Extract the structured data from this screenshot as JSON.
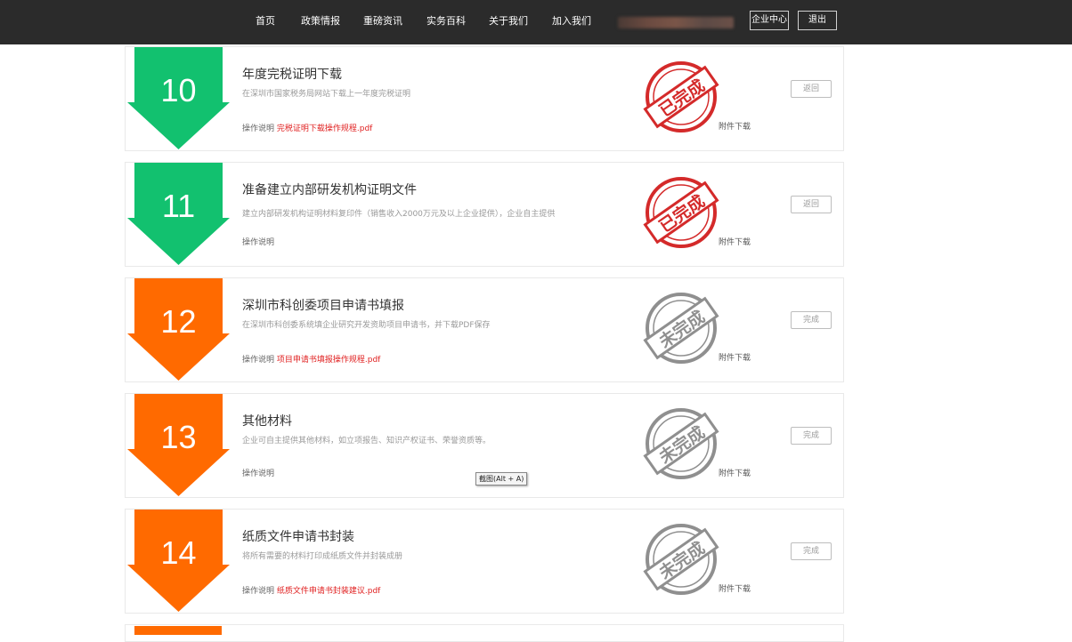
{
  "colors": {
    "topbar": "#2b2b2b",
    "done_arrow": "#12c16f",
    "pending_arrow": "#ff6a00",
    "stamp_done": "#d42a2a",
    "stamp_pending": "#8f8f8f",
    "link_file": "#e02020"
  },
  "nav": {
    "items": [
      {
        "label": "首页"
      },
      {
        "label": "政策情报"
      },
      {
        "label": "重磅资讯"
      },
      {
        "label": "实务百科"
      },
      {
        "label": "关于我们"
      },
      {
        "label": "加入我们"
      }
    ],
    "enterprise_center": "企业中心",
    "logout": "退出"
  },
  "steps": [
    {
      "number": "10",
      "status": "done",
      "title": "年度完税证明下载",
      "desc": "在深圳市国家税务局网站下载上一年度完税证明",
      "ops_label": "操作说明",
      "ops_file": "完税证明下载操作规程.pdf",
      "stamp_text": "已完成",
      "attach": "附件下载",
      "button": "返回"
    },
    {
      "number": "11",
      "status": "done",
      "title": "准备建立内部研发机构证明文件",
      "desc": "建立内部研发机构证明材料复印件（销售收入2000万元及以上企业提供），企业自主提供",
      "ops_label": "操作说明",
      "ops_file": "",
      "stamp_text": "已完成",
      "attach": "附件下载",
      "button": "返回"
    },
    {
      "number": "12",
      "status": "pending",
      "title": "深圳市科创委项目申请书填报",
      "desc": "在深圳市科创委系统填企业研究开发资助项目申请书，并下载PDF保存",
      "ops_label": "操作说明",
      "ops_file": "项目申请书填报操作规程.pdf",
      "stamp_text": "未完成",
      "attach": "附件下载",
      "button": "完成"
    },
    {
      "number": "13",
      "status": "pending",
      "title": "其他材料",
      "desc": "企业可自主提供其他材料，如立项报告、知识产权证书、荣誉资质等。",
      "ops_label": "操作说明",
      "ops_file": "",
      "stamp_text": "未完成",
      "attach": "附件下载",
      "button": "完成"
    },
    {
      "number": "14",
      "status": "pending",
      "title": "纸质文件申请书封装",
      "desc": "将所有需要的材料打印成纸质文件并封装成册",
      "ops_label": "操作说明",
      "ops_file": "纸质文件申请书封装建议.pdf",
      "stamp_text": "未完成",
      "attach": "附件下载",
      "button": "完成"
    }
  ],
  "tooltip": "截图(Alt + A)"
}
